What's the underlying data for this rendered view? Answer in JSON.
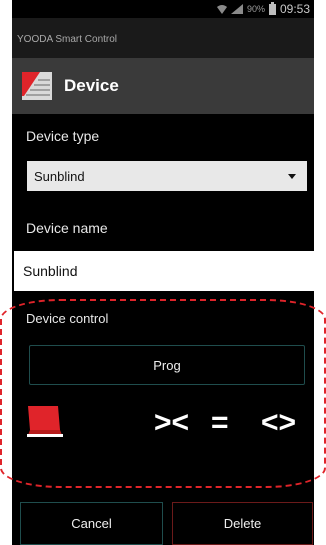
{
  "status_bar": {
    "battery_pct": "90%",
    "time": "09:53"
  },
  "app_title": "YOODA Smart Control",
  "header": {
    "title": "Device",
    "logo_icon": "blind-logo-icon"
  },
  "device_type": {
    "label": "Device type",
    "selected": "Sunblind"
  },
  "device_name": {
    "label": "Device name",
    "value": "Sunblind"
  },
  "device_control": {
    "label": "Device control",
    "prog_label": "Prog",
    "close_glyph": "><",
    "stop_glyph": "=",
    "open_glyph": "<>"
  },
  "footer": {
    "cancel_label": "Cancel",
    "delete_label": "Delete"
  },
  "colors": {
    "accent_red": "#e0242a",
    "header_bg": "#3a3a3a",
    "button_border": "#1f4d4d"
  }
}
